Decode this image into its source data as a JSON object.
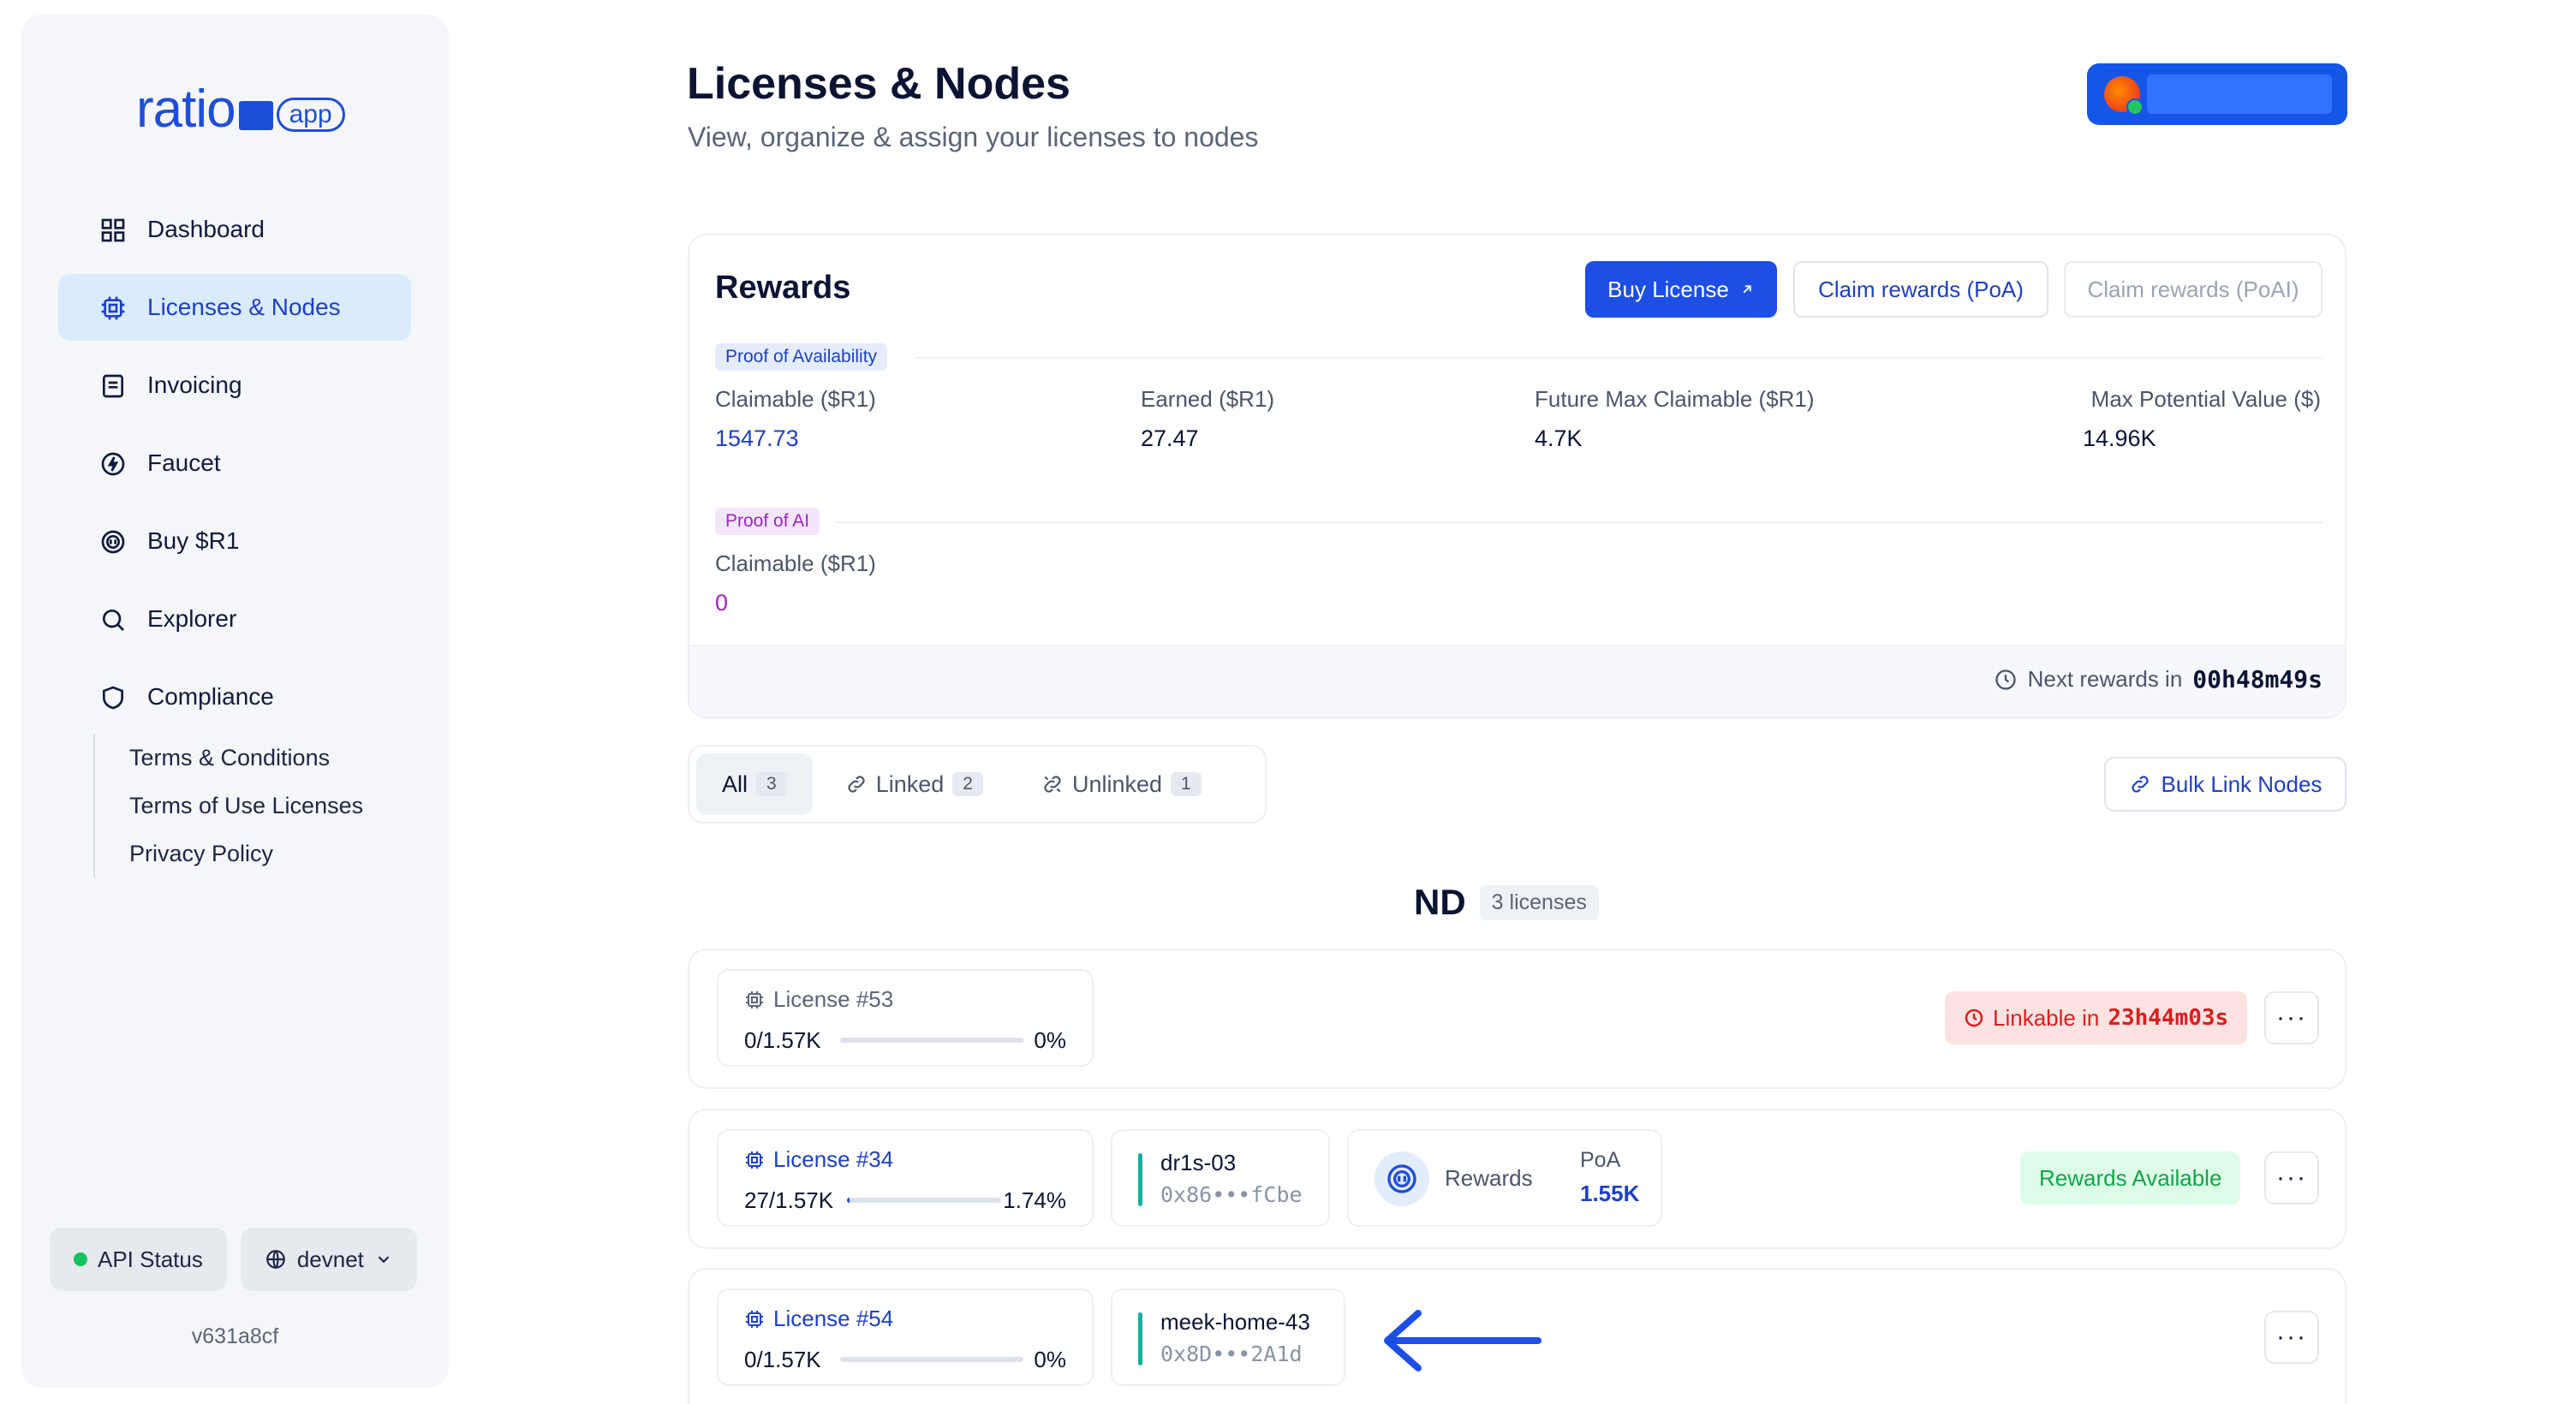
{
  "sidebar": {
    "logo": {
      "word": "ratio",
      "pill": "app"
    },
    "nav": [
      {
        "label": "Dashboard",
        "icon": "dashboard-icon"
      },
      {
        "label": "Licenses & Nodes",
        "icon": "chip-icon",
        "active": true
      },
      {
        "label": "Invoicing",
        "icon": "document-icon"
      },
      {
        "label": "Faucet",
        "icon": "bolt-icon"
      },
      {
        "label": "Buy $R1",
        "icon": "coin-icon"
      },
      {
        "label": "Explorer",
        "icon": "search-icon"
      },
      {
        "label": "Compliance",
        "icon": "shield-icon"
      }
    ],
    "compliance_links": [
      "Terms & Conditions",
      "Terms of Use Licenses",
      "Privacy Policy"
    ],
    "api_status": "API Status",
    "network": "devnet",
    "version": "v631a8cf"
  },
  "header": {
    "title": "Licenses & Nodes",
    "subtitle": "View, organize & assign your licenses to nodes"
  },
  "rewards": {
    "title": "Rewards",
    "buy_license": "Buy License",
    "claim_poa": "Claim rewards (PoA)",
    "claim_poai": "Claim rewards (PoAI)",
    "poa_tag": "Proof of Availability",
    "poa_stats": [
      {
        "label": "Claimable ($R1)",
        "value": "1547.73"
      },
      {
        "label": "Earned ($R1)",
        "value": "27.47"
      },
      {
        "label": "Future Max Claimable ($R1)",
        "value": "4.7K"
      },
      {
        "label": "Max Potential Value ($)",
        "value": "14.96K"
      }
    ],
    "poai_tag": "Proof of AI",
    "poai_stat": {
      "label": "Claimable ($R1)",
      "value": "0"
    },
    "next_label": "Next rewards in",
    "next_value": "00h48m49s"
  },
  "filters": {
    "tabs": [
      {
        "label": "All",
        "count": "3"
      },
      {
        "label": "Linked",
        "count": "2"
      },
      {
        "label": "Unlinked",
        "count": "1"
      }
    ],
    "bulk_link": "Bulk Link Nodes"
  },
  "group": {
    "name": "ND",
    "count": "3 licenses"
  },
  "licenses": [
    {
      "name": "License #53",
      "usage": "0/1.57K",
      "percent": "0%",
      "fill": 0,
      "badge": "Linkable in",
      "badge_time": "23h44m03s"
    },
    {
      "name": "License #34",
      "usage": "27/1.57K",
      "percent": "1.74%",
      "fill": 0.0174,
      "node_name": "dr1s-03",
      "node_addr": "0x86•••fCbe",
      "rewards_label": "Rewards",
      "poa_label": "PoA",
      "poa_value": "1.55K",
      "badge": "Rewards Available"
    },
    {
      "name": "License #54",
      "usage": "0/1.57K",
      "percent": "0%",
      "fill": 0,
      "node_name": "meek-home-43",
      "node_addr": "0x8D•••2A1d"
    }
  ],
  "more_label": "···",
  "colors": {
    "accent": "#1d4ee5",
    "active_nav_bg": "#d9ebfd",
    "poai": "#9d26c0",
    "linked": "#10b39a"
  }
}
